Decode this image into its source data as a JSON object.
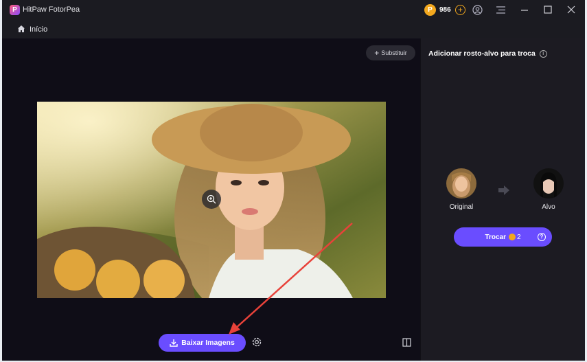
{
  "app": {
    "title": "HitPaw FotorPea",
    "logo_letter": "P"
  },
  "account": {
    "coin_symbol": "P",
    "coins": "986",
    "add_symbol": "+"
  },
  "nav": {
    "home_label": "Início"
  },
  "toolbar": {
    "replace_label": "Substituir"
  },
  "preview": {
    "download_label": "Baixar Imagens"
  },
  "panel": {
    "title": "Adicionar rosto-alvo para troca",
    "info_symbol": "i",
    "original_label": "Original",
    "target_label": "Alvo",
    "swap_label": "Trocar",
    "swap_cost": "2",
    "help_symbol": "?"
  },
  "colors": {
    "accent": "#6a4dff",
    "coin": "#f3a81e",
    "window_bg": "#111016",
    "panel_bg": "#1c1b22",
    "annotation_arrow": "#e8423a"
  }
}
